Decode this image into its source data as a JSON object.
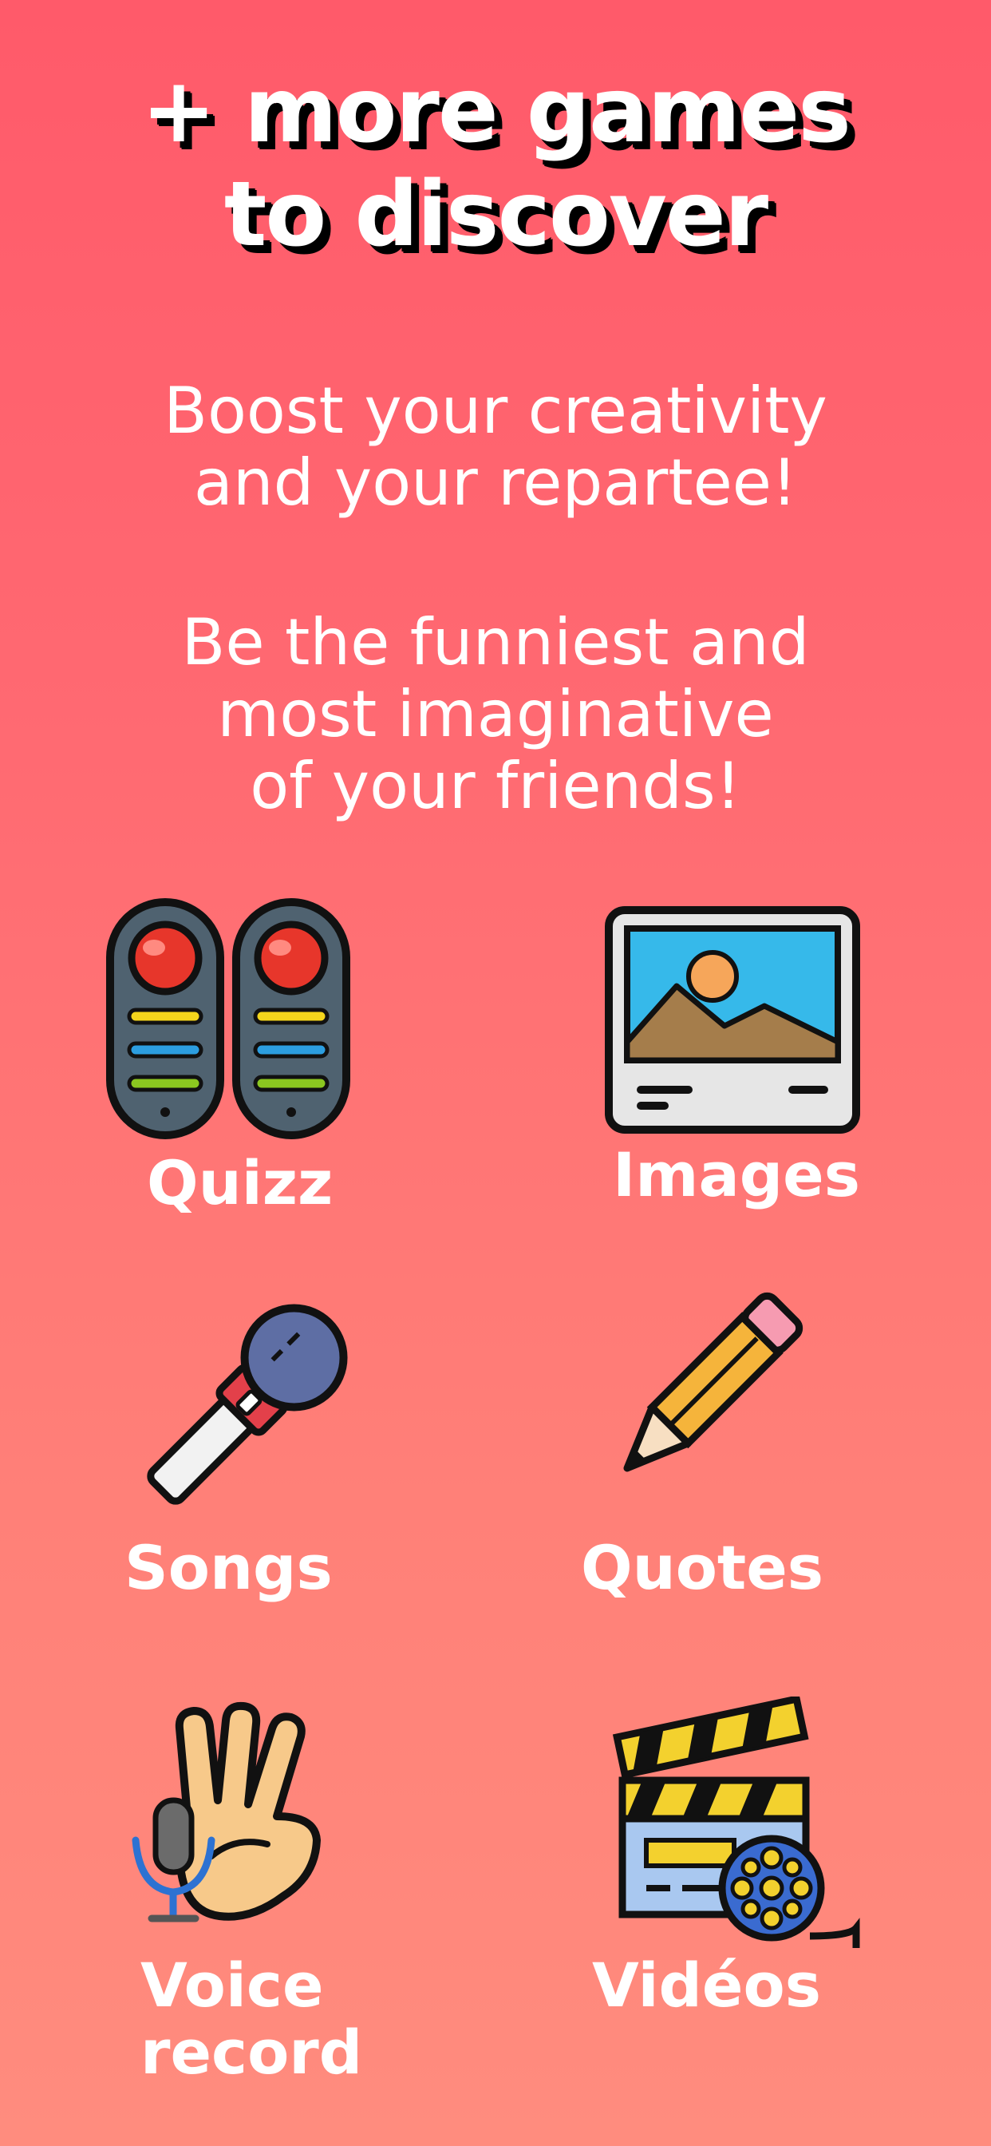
{
  "headline": {
    "line1": "+ more games",
    "line2": "to discover"
  },
  "subtitle": {
    "line1": "Boost your creativity",
    "line2": "and your repartee!"
  },
  "tagline": {
    "line1": "Be the funniest and",
    "line2": "most imaginative",
    "line3": "of your friends!"
  },
  "games": [
    {
      "label": "Quizz",
      "icon": "buzzer-icon"
    },
    {
      "label": "Images",
      "icon": "picture-icon"
    },
    {
      "label": "Songs",
      "icon": "microphone-icon"
    },
    {
      "label": "Quotes",
      "icon": "pencil-icon"
    },
    {
      "label_line1": "Voice",
      "label_line2": "record",
      "icon": "voice-hand-icon"
    },
    {
      "label": "Vidéos",
      "icon": "clapperboard-icon"
    }
  ],
  "colors": {
    "background_top": "#ff5a6a",
    "background_bottom": "#ff8c7e",
    "text": "#ffffff",
    "shadow": "#000000"
  }
}
